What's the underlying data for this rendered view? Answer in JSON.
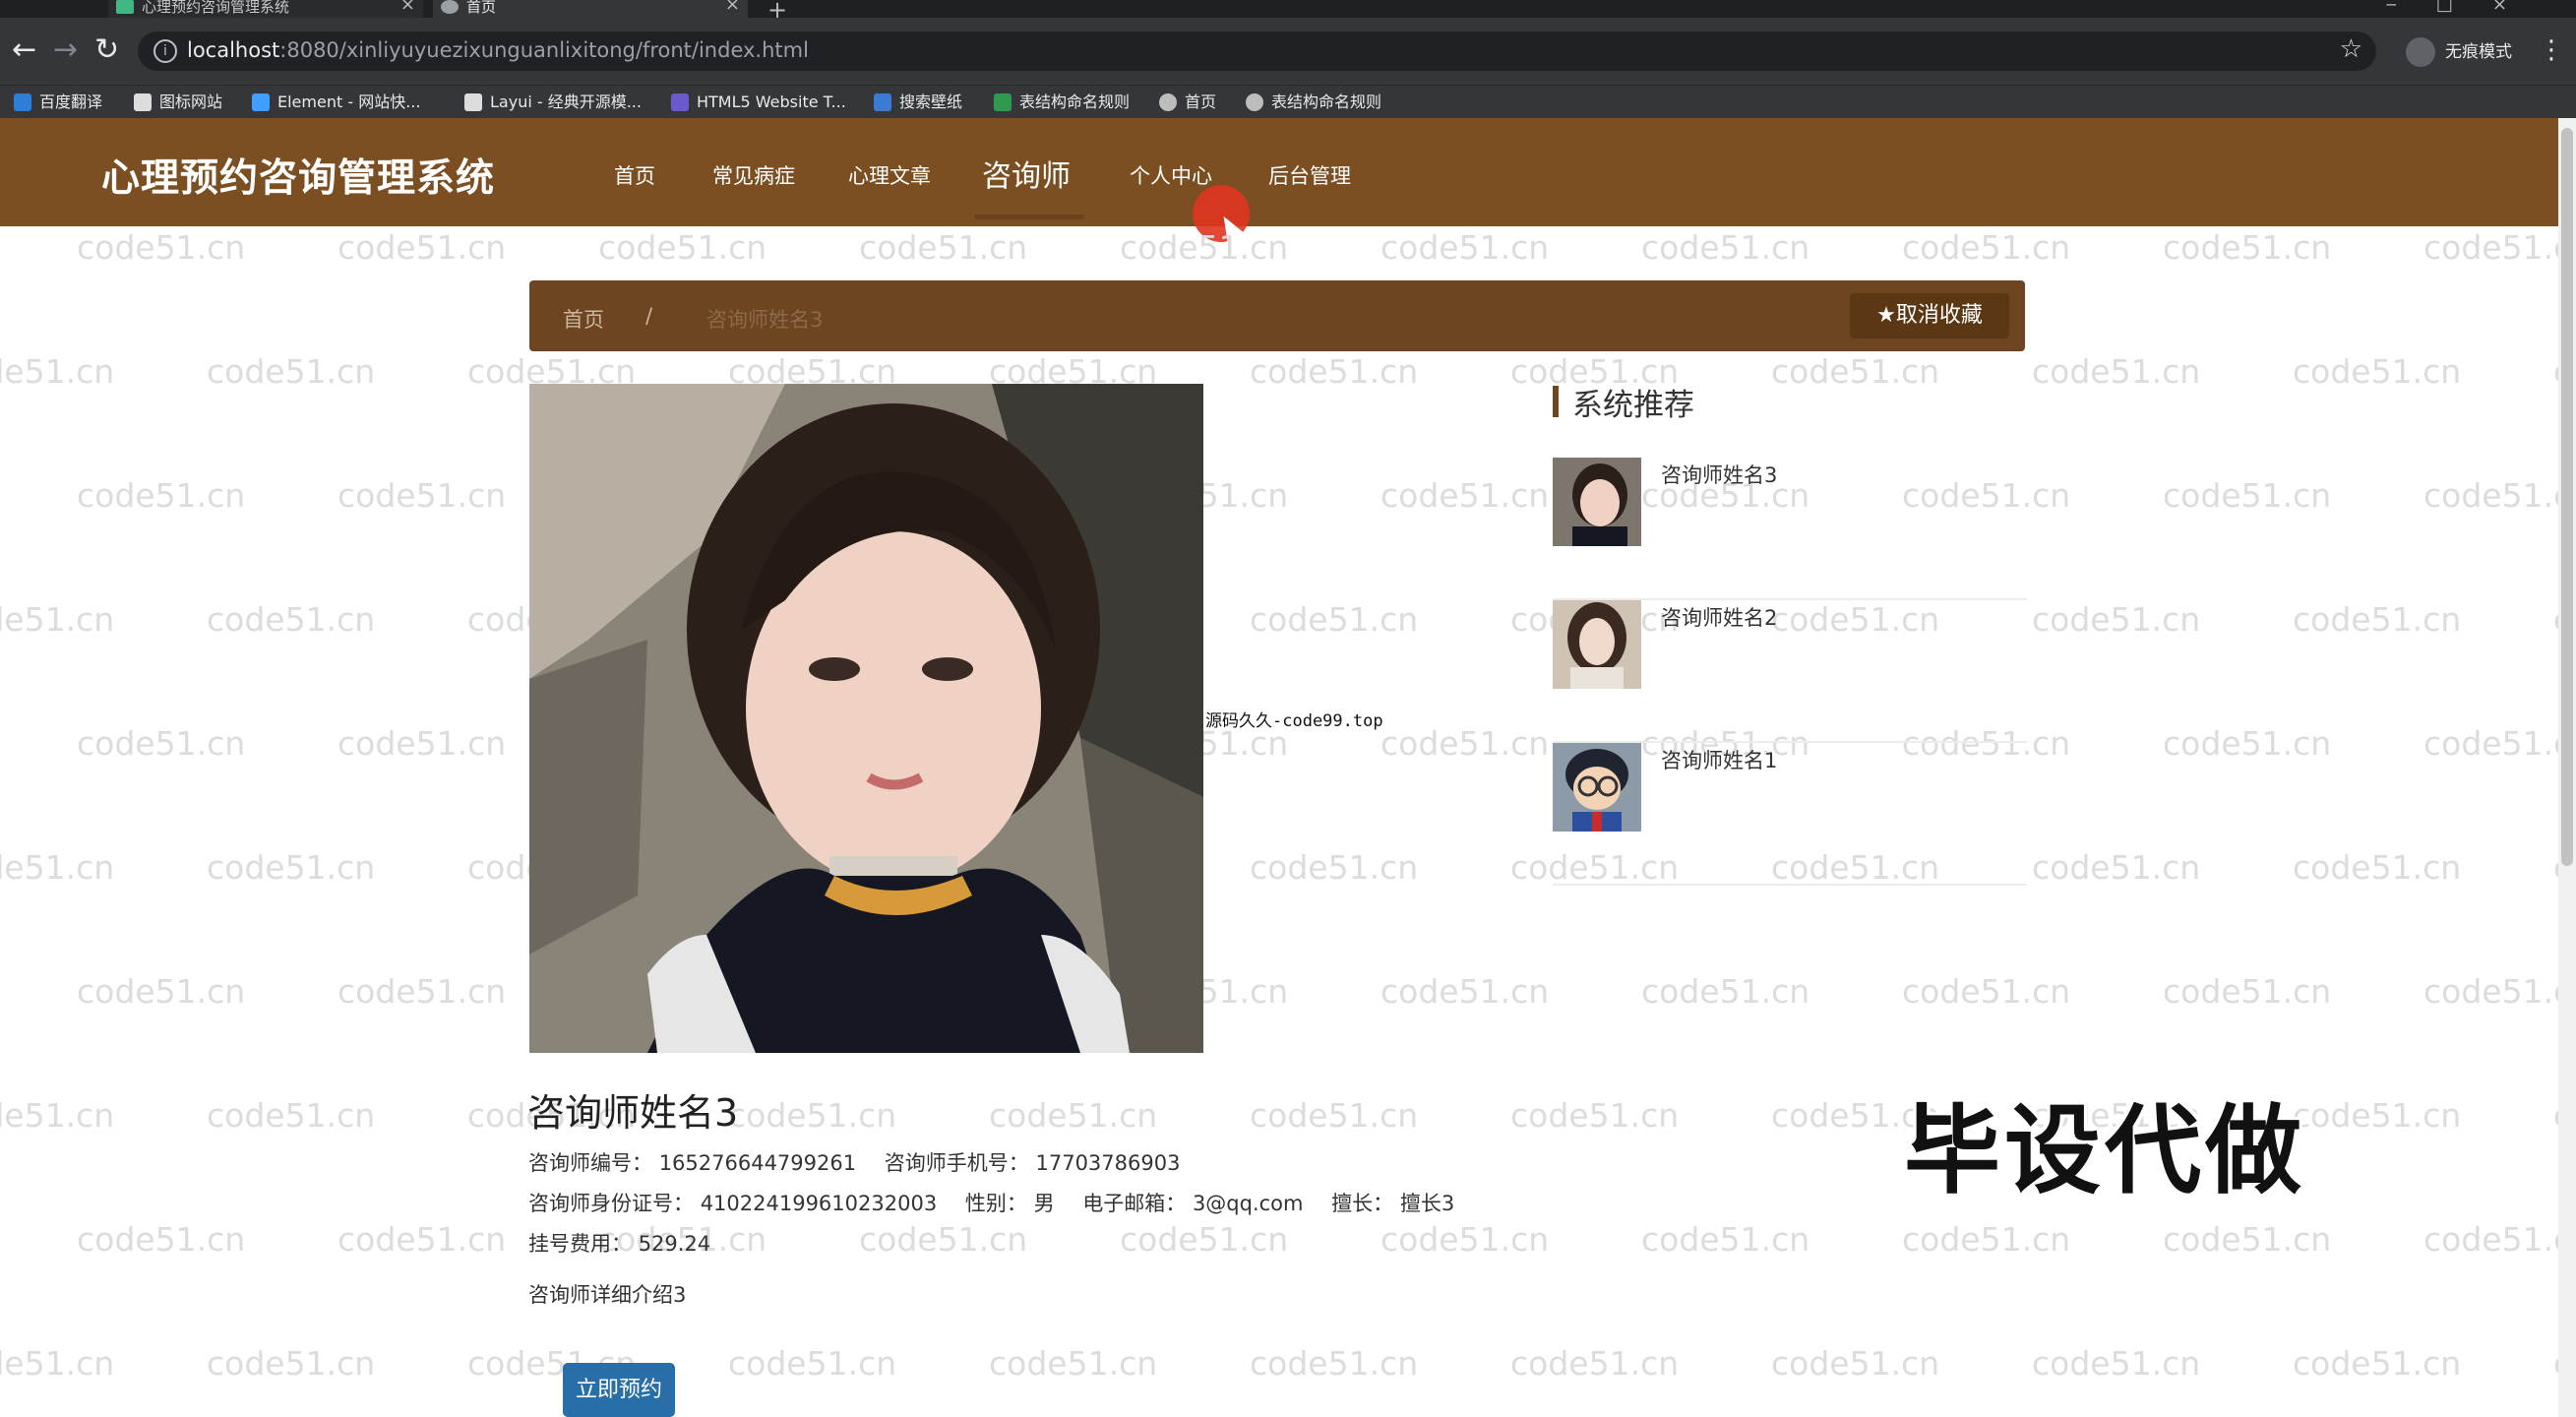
{
  "browser": {
    "tabs": [
      {
        "title": "心理预约咨询管理系统"
      },
      {
        "title": "首页"
      }
    ],
    "url_host": "localhost",
    "url_rest": ":8080/xinliyuyuezixunguanlixitong/front/index.html",
    "incognito_label": "无痕模式",
    "bookmarks": [
      {
        "label": "百度翻译",
        "color": "#2e7dd7"
      },
      {
        "label": "图标网站",
        "color": "#dddddd"
      },
      {
        "label": "Element - 网站快...",
        "color": "#409eff"
      },
      {
        "label": "Layui - 经典开源模...",
        "color": "#dddddd"
      },
      {
        "label": "HTML5 Website T...",
        "color": "#6a5acd"
      },
      {
        "label": "搜索壁纸",
        "color": "#3a7bd5"
      },
      {
        "label": "表结构命名规则",
        "color": "#2e9a4f"
      },
      {
        "label": "首页",
        "color": "#bdbdbd"
      },
      {
        "label": "表结构命名规则",
        "color": "#bdbdbd"
      }
    ]
  },
  "site": {
    "logo": "心理预约咨询管理系统",
    "nav": [
      {
        "label": "首页"
      },
      {
        "label": "常见病症"
      },
      {
        "label": "心理文章"
      },
      {
        "label": "咨询师",
        "active": true
      },
      {
        "label": "个人中心"
      },
      {
        "label": "后台管理"
      }
    ],
    "accent_color": "#7b4f22"
  },
  "watermark": "code51.cn",
  "breadcrumb": {
    "home": "首页",
    "separator": "/",
    "current": "咨询师姓名3",
    "favorite_button": "取消收藏"
  },
  "overlay_note": "源码久久-code99.top",
  "recommend": {
    "title": "系统推荐",
    "items": [
      {
        "name": "咨询师姓名3"
      },
      {
        "name": "咨询师姓名2"
      },
      {
        "name": "咨询师姓名1"
      }
    ]
  },
  "detail": {
    "name": "咨询师姓名3",
    "id_label": "咨询师编号：",
    "id_value": "165276644799261",
    "phone_label": "咨询师手机号：",
    "phone_value": "17703786903",
    "idcard_label": "咨询师身份证号：",
    "idcard_value": "410224199610232003",
    "gender_label": "性别：",
    "gender_value": "男",
    "email_label": "电子邮箱：",
    "email_value": "3@qq.com",
    "specialty_label": "擅长：",
    "specialty_value": "擅长3",
    "fee_label": "挂号费用：",
    "fee_value": "529.24",
    "intro": "咨询师详细介绍3",
    "book_button": "立即预约"
  },
  "promo_text": "毕设代做"
}
